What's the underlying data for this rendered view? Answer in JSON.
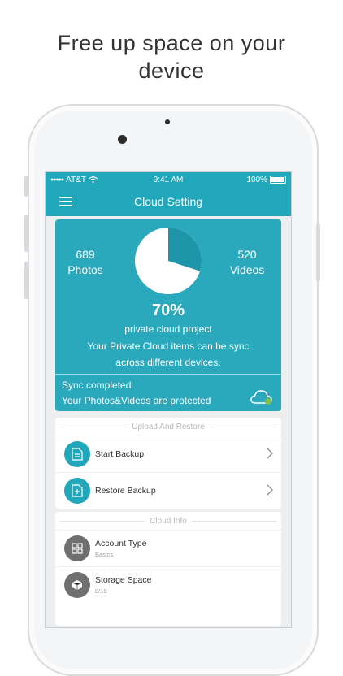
{
  "headline": {
    "line1": "Free up space on your",
    "line2": "device"
  },
  "status_bar": {
    "carrier": "AT&T",
    "time": "9:41 AM",
    "battery": "100%"
  },
  "navbar": {
    "title": "Cloud Setting"
  },
  "summary": {
    "photos_count": "689",
    "photos_label": "Photos",
    "videos_count": "520",
    "videos_label": "Videos",
    "percent": "70%",
    "percent_value": 0.7,
    "project_label": "private cloud project",
    "description_line1": "Your Private Cloud items can be sync",
    "description_line2": "across different devices.",
    "sync_status": "Sync completed",
    "sync_detail": "Your Photos&Videos are protected"
  },
  "upload_restore": {
    "header": "Upload And Restore",
    "items": [
      {
        "label": "Start Backup",
        "icon": "upload-file-icon"
      },
      {
        "label": "Restore Backup",
        "icon": "restore-file-icon"
      }
    ]
  },
  "cloud_info": {
    "header": "Cloud Info",
    "items": [
      {
        "label": "Account Type",
        "value": "Basics",
        "icon": "grid-icon"
      },
      {
        "label": "Storage Space",
        "value": "0/10",
        "icon": "box-icon"
      }
    ]
  },
  "colors": {
    "accent": "#21a7ba",
    "card": "#2ba9bc",
    "pie_fill": "#ffffff",
    "pie_slice": "#1e95a8"
  }
}
